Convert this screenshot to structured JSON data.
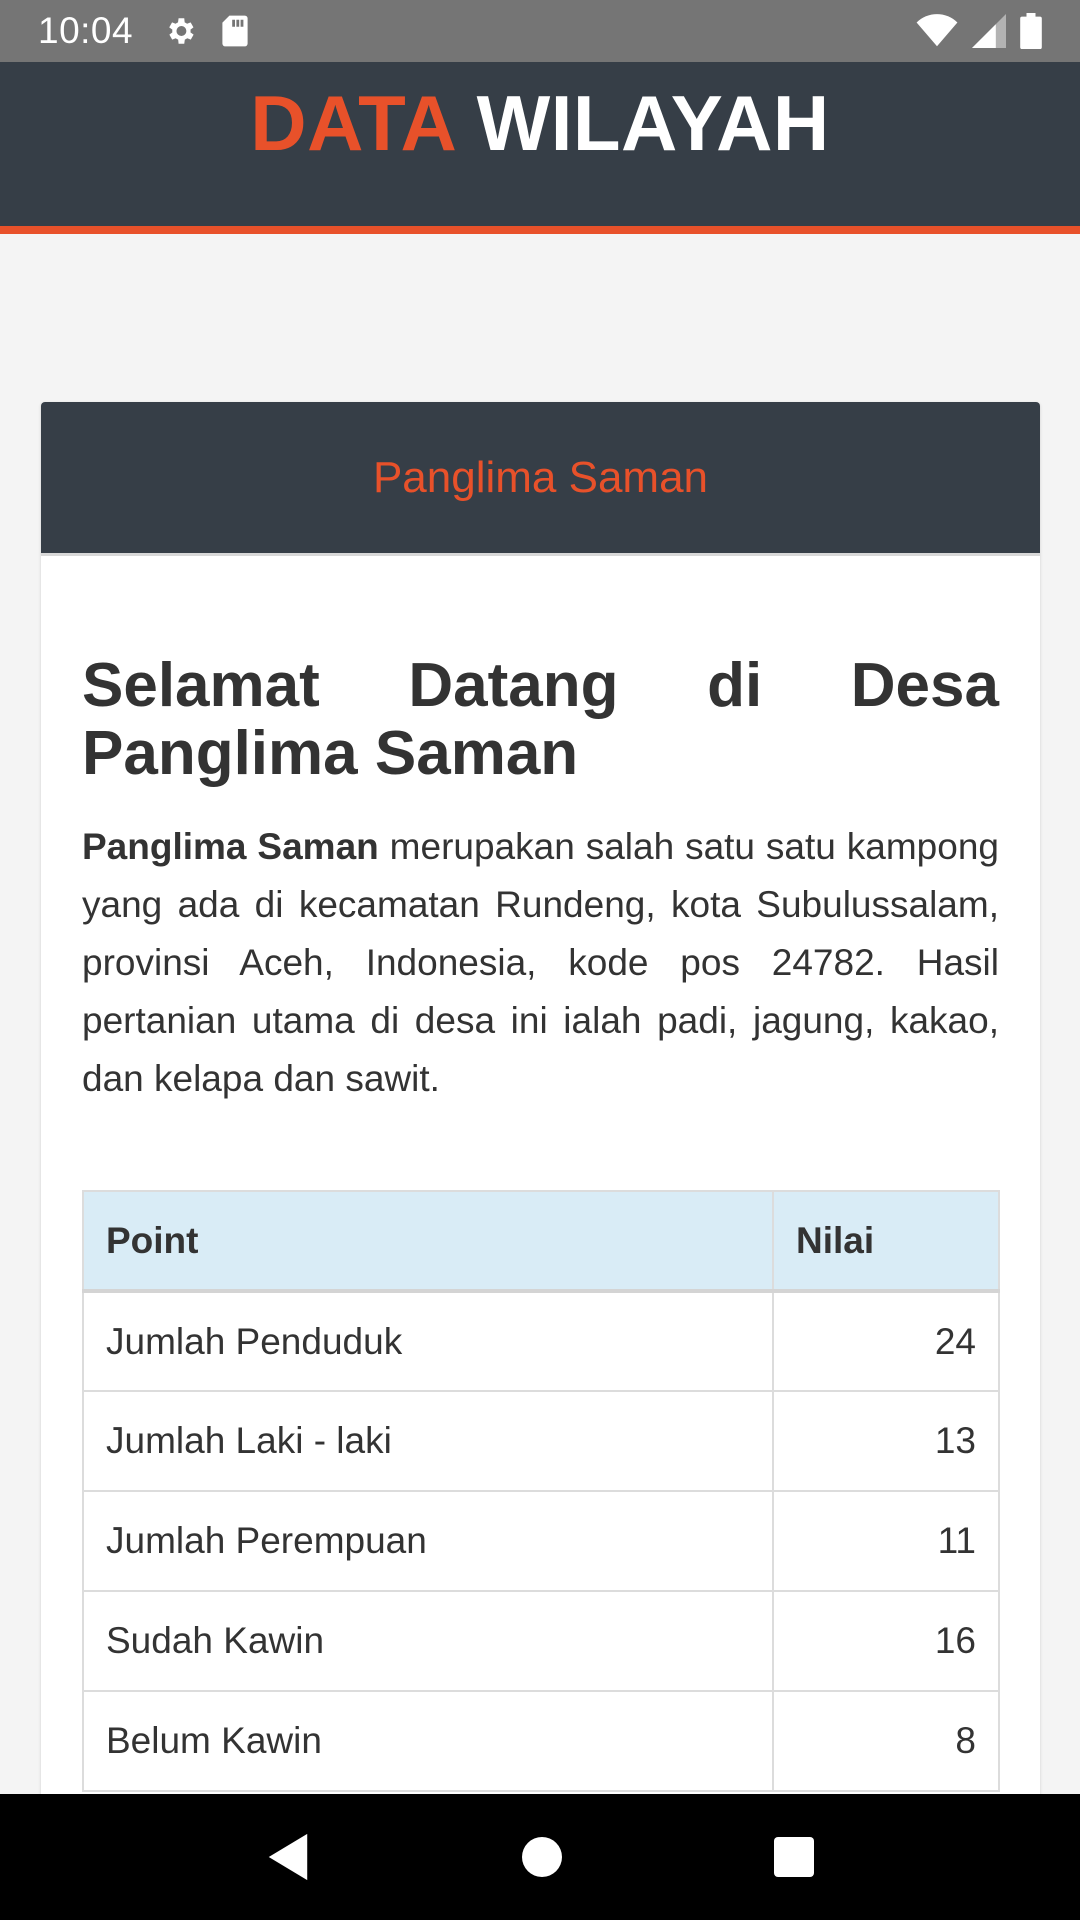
{
  "status_bar": {
    "time": "10:04",
    "icons": [
      "gear-icon",
      "sd-card-icon",
      "wifi-icon",
      "signal-icon",
      "battery-icon"
    ]
  },
  "header": {
    "title_accent": "DATA",
    "title_rest": "WILAYAH"
  },
  "card": {
    "title": "Panglima Saman",
    "heading": "Selamat Datang di Desa Panglima Saman",
    "description_bold": "Panglima Saman",
    "description_text": " merupakan salah satu satu kampong yang ada di kecamatan Rundeng, kota Subulussalam, provinsi Aceh, Indonesia, kode pos 24782. Hasil pertanian utama di desa ini ialah padi, jagung, kakao, dan kelapa dan sawit."
  },
  "table": {
    "headers": [
      "Point",
      "Nilai"
    ],
    "rows": [
      {
        "point": "Jumlah Penduduk",
        "nilai": "24"
      },
      {
        "point": "Jumlah Laki - laki",
        "nilai": "13"
      },
      {
        "point": "Jumlah Perempuan",
        "nilai": "11"
      },
      {
        "point": "Sudah Kawin",
        "nilai": "16"
      },
      {
        "point": "Belum Kawin",
        "nilai": "8"
      }
    ]
  },
  "nav_bar": {
    "icons": [
      "back-icon",
      "home-icon",
      "recents-icon"
    ]
  },
  "colors": {
    "accent": "#e8512a",
    "header_bg": "#363e47",
    "table_header_bg": "#d9ecf6"
  }
}
